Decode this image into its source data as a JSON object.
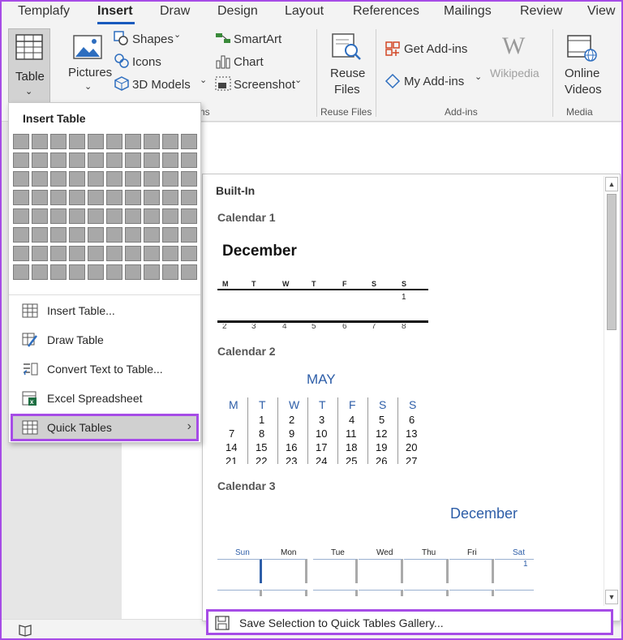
{
  "tabs": {
    "items": [
      "Templafy",
      "Insert",
      "Draw",
      "Design",
      "Layout",
      "References",
      "Mailings",
      "Review",
      "View"
    ],
    "active": "Insert"
  },
  "ribbon": {
    "table": "Table",
    "pictures": "Pictures",
    "shapes": "Shapes",
    "icons": "Icons",
    "models": "3D Models",
    "smartart": "SmartArt",
    "chart": "Chart",
    "screenshot": "Screenshot",
    "reuse_files": [
      "Reuse",
      "Files"
    ],
    "get_addins": "Get Add-ins",
    "my_addins": "My Add-ins",
    "wikipedia": "Wikipedia",
    "online_videos": [
      "Online",
      "Videos"
    ],
    "groups": {
      "illustrations_tail": "ns",
      "reuse": "Reuse Files",
      "addins": "Add-ins",
      "media": "Media"
    }
  },
  "menu": {
    "title": "Insert Table",
    "items": [
      {
        "label": "Insert Table...",
        "icon": "insert-table-icon"
      },
      {
        "label": "Draw Table",
        "icon": "draw-table-icon"
      },
      {
        "label": "Convert Text to Table...",
        "icon": "convert-text-icon"
      },
      {
        "label": "Excel Spreadsheet",
        "icon": "excel-icon"
      },
      {
        "label": "Quick Tables",
        "icon": "quick-tables-icon"
      }
    ]
  },
  "gallery": {
    "section": "Built-In",
    "cal1": {
      "title": "Calendar 1",
      "month": "December",
      "days": [
        "M",
        "T",
        "W",
        "T",
        "F",
        "S",
        "S"
      ],
      "first": "1",
      "partial": [
        "2",
        "3",
        "4",
        "5",
        "6",
        "7",
        "8"
      ]
    },
    "cal2": {
      "title": "Calendar 2",
      "month": "MAY",
      "days": [
        "M",
        "T",
        "W",
        "T",
        "F",
        "S",
        "S"
      ],
      "rows": [
        [
          "",
          "1",
          "2",
          "3",
          "4",
          "5",
          "6"
        ],
        [
          "7",
          "8",
          "9",
          "10",
          "11",
          "12",
          "13"
        ],
        [
          "14",
          "15",
          "16",
          "17",
          "18",
          "19",
          "20"
        ],
        [
          "21",
          "22",
          "23",
          "24",
          "25",
          "26",
          "27"
        ]
      ]
    },
    "cal3": {
      "title": "Calendar 3",
      "month": "December",
      "days": [
        "Sun",
        "Mon",
        "Tue",
        "Wed",
        "Thu",
        "Fri",
        "Sat"
      ],
      "first": "1"
    },
    "save": "Save Selection to Quick Tables Gallery..."
  },
  "colors": {
    "accent": "#185abd",
    "highlight": "#a64ce6",
    "cal_blue": "#2e5ea8"
  }
}
